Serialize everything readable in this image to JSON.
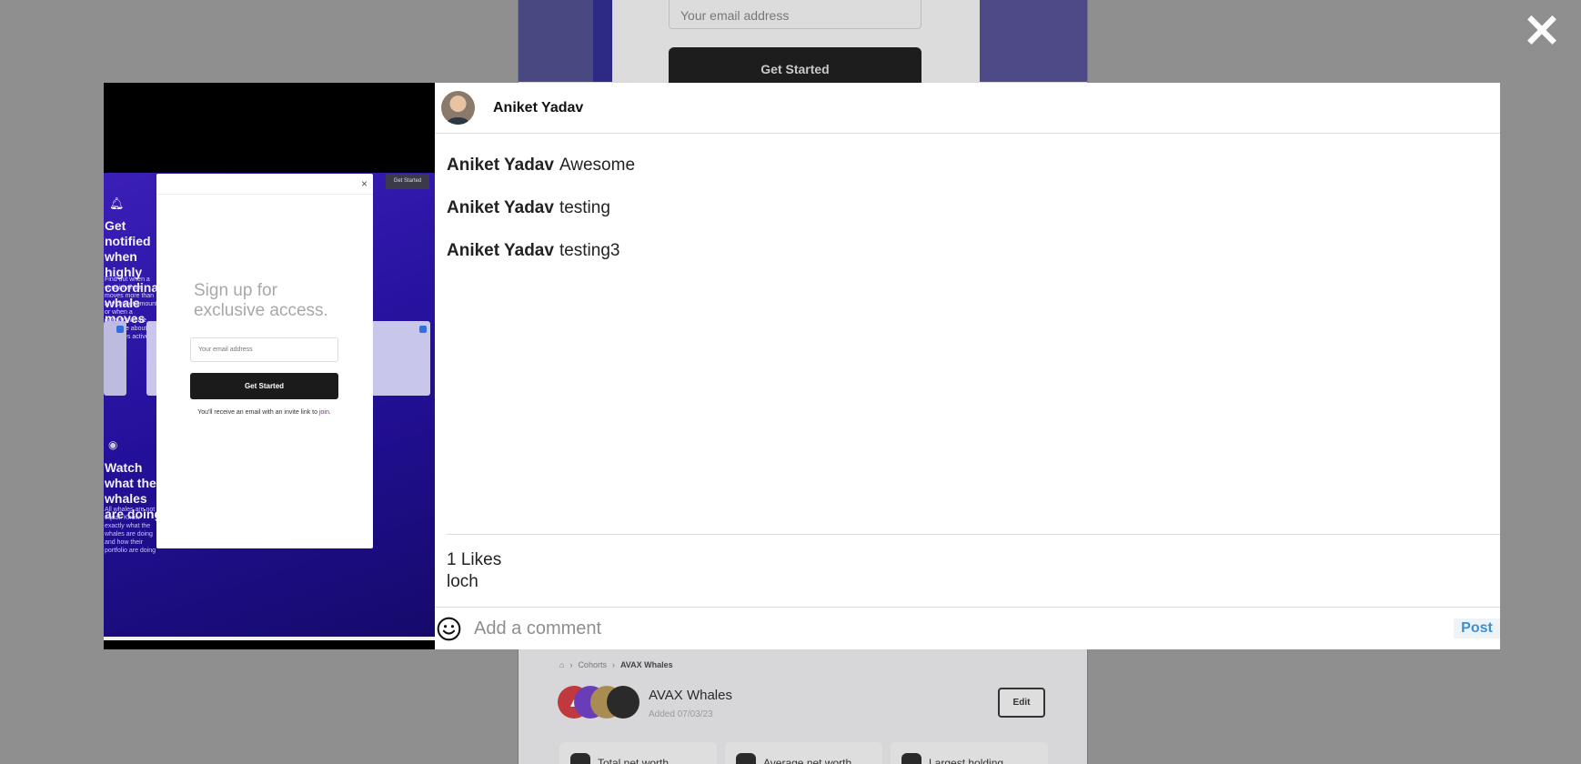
{
  "background": {
    "email_placeholder": "Your email address",
    "get_started_label": "Get Started",
    "breadcrumb": [
      "Cohorts",
      "AVAX Whales"
    ],
    "cohort_title": "AVAX Whales",
    "cohort_date": "Added 07/03/23",
    "edit_label": "Edit",
    "stats": [
      "Total net worth",
      "Average net worth",
      "Largest holding"
    ]
  },
  "close_icon": "×",
  "media": {
    "top_button": "Get Started",
    "heading1": "Get notified when highly coordinated whale moves",
    "sub1": "Find out when a certain whale moves more than any preset amount or when a dormant whale you care about becomes active",
    "heading2": "Watch what the whales are doing",
    "sub2": "All whales are not equal. Know exactly what the whales are doing and how their portfolio are doing",
    "popup": {
      "close": "×",
      "title": "Sign up for exclusive access.",
      "email_placeholder": "Your email address",
      "button": "Get Started",
      "note_prefix": "You'll receive an email with an invite link to ",
      "note_link": "join",
      "note_suffix": "."
    }
  },
  "post": {
    "author": "Aniket Yadav",
    "comments": [
      {
        "author": "Aniket Yadav",
        "text": "Awesome"
      },
      {
        "author": "Aniket Yadav",
        "text": "testing"
      },
      {
        "author": "Aniket Yadav",
        "text": "testing3"
      }
    ],
    "likes": "1 Likes",
    "caption": "loch",
    "comment_placeholder": "Add a comment",
    "post_label": "Post",
    "emoji_icon": "smiley-icon"
  },
  "colors": {
    "overlay": "#8f8f8f",
    "post_link": "#3b8fd4",
    "media_gradient_start": "#3b1fb8",
    "media_gradient_end": "#150a6b"
  }
}
